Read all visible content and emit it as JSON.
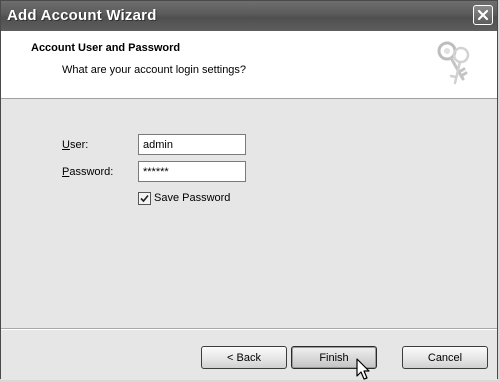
{
  "window": {
    "title": "Add Account Wizard",
    "close_icon": "close-x-icon"
  },
  "header": {
    "title": "Account User and Password",
    "subtitle": "What are your account login settings?",
    "art_icon": "keys-icon"
  },
  "form": {
    "user": {
      "label_mnemonic": "U",
      "label_rest": "ser:",
      "value": "admin"
    },
    "password": {
      "label_mnemonic": "P",
      "label_rest": "assword:",
      "value": "******"
    },
    "save_password": {
      "label": "Save Password",
      "checked": true
    }
  },
  "buttons": {
    "back": "< Back",
    "finish": "Finish",
    "cancel": "Cancel"
  },
  "colors": {
    "titlebar": "#5a5a5a",
    "header_bg": "#ffffff",
    "body_bg": "#e6e6e6"
  }
}
